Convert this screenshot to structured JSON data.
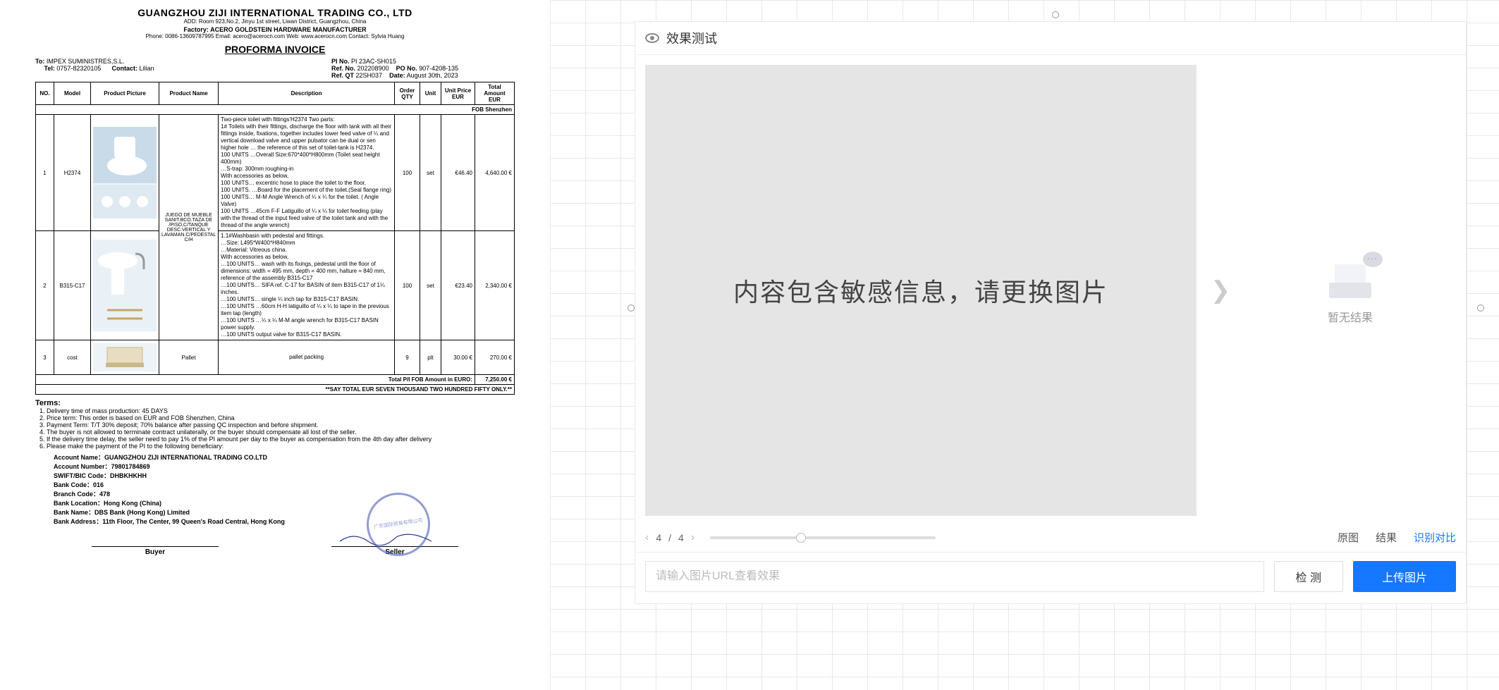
{
  "invoice": {
    "company": "GUANGZHOU ZIJI INTERNATIONAL TRADING CO., LTD",
    "address": "ADD: Room 923,No.2, Jinyu 1st street, Liwan District, Guangzhou, China",
    "factory": "Factory: ACERO GOLDSTEIN HARDWARE MANUFACTURER",
    "contacts": "Phone: 0086-13609787995    Email: acero@acerocn.com    Web: www.acerocn.com    Contact: Sylvia Huang",
    "title": "PROFORMA  INVOICE",
    "to_label": "To:",
    "to": "IMPEX SUMINISTRES,S.L.",
    "tel_label": "Tel:",
    "tel": "0757-82320105",
    "contact_label": "Contact:",
    "contact": "Lilian",
    "pi_no_label": "PI No.",
    "pi_no": "PI 23AC-SH015",
    "ref_no_label": "Ref. No.",
    "ref_no": "202208900",
    "po_no_label": "PO No.",
    "po_no": "907-4208-135",
    "ref_qt_label": "Ref. QT",
    "ref_qt": "22SH037",
    "date_label": "Date:",
    "date": "August 30th, 2023",
    "headers": {
      "no": "NO.",
      "model": "Model",
      "pic": "Product Picture",
      "name": "Product Name",
      "desc": "Description",
      "qty": "Order QTY",
      "unit": "Unit",
      "price": "Unit Price EUR",
      "amount": "Total Amount EUR"
    },
    "fob": "FOB Shenzhen",
    "name_block": "JUEGO DE MUEBLE SANIT.BCO.TAZA DE /PISO,C/TANQUE DESC.VERTICAL Y LAVAMAN.C/PEDESTAL C/H",
    "rows": [
      {
        "no": "1",
        "model": "H2374",
        "desc": "Two-piece toilet with fittings'H2374 Two parts:\n1# Toilets with their fittings, discharge the floor with tank with all their fittings inside, fixations, together includes lower feed valve of ¼ and vertical download valve and upper pulsator can be dual or sen higher hole … the reference of this set of toilet-tank is H2374.\n100 UNITS …Overall Size:670*400*H800mm (Toilet seat height 400mm)\n…S-trap: 300mm roughing-in\nWith accessories as below,\n100 UNITS… excentric hose to place the toilet to the floor,\n100 UNITS. …Board for the placement of the toilet.(Seal flange ring)\n100 UNITS… M-M Angle Wrench of ¼ x ¼ for the toilet. ( Angle Valve)\n100 UNITS …45cm F-F Latiguillo of ¼ x ¼ for toilet feeding (play with the thread of the input feed valve of the toilet tank and with the thread of the angle wrench)",
        "qty": "100",
        "unit": "set",
        "price": "€46.40",
        "amount": "4,640.00 €"
      },
      {
        "no": "2",
        "model": "B315-C17",
        "desc": "1.1#Washbasin with pedestal and fittings.\n…Size: L495*W400*H840mm\n…Material: Vitreous china.\nWith accessories as below,\n…100 UNITS… wash with its fixings, pedestal until the floor of dimensions: width = 495 mm, depth = 400 mm, halture = 840 mm, reference of the assembly B315-C17\n…100 UNITS… SIFA ref. C-17 for BASIN of item B315-C17 of 1¼ inches.\n…100 UNITS… single ¼ inch tap for B315-C17 BASIN.\n…100 UNITS …60cm H-H latiguillo of ¼ x ¼ to tape in the previous item tap (length)\n…100 UNITS …¼ x ¼ M-M angle wrench for B315-C17 BASIN power supply.\n…100 UNITS output valve for B315-C17 BASIN.",
        "qty": "100",
        "unit": "set",
        "price": "€23.40",
        "amount": "2,340.00 €"
      },
      {
        "no": "3",
        "model": "cost",
        "name": "Pallet",
        "desc": "pallet packing",
        "qty": "9",
        "unit": "plt",
        "price": "30.00 €",
        "amount": "270.00 €"
      }
    ],
    "total_label": "Total P/I FOB Amount in EURO:",
    "total": "7,250.00 €",
    "words": "**SAY TOTAL EUR SEVEN THOUSAND TWO HUNDRED FIFTY ONLY.**",
    "terms_hdr": "Terms:",
    "terms": [
      "Delivery time of mass production: 45 DAYS",
      "Price term: This order is based on EUR and FOB Shenzhen, China",
      "Payment Term: T/T 30% deposit; 70% balance after passing QC inspection and before shipment.",
      "The buyer is not allowed to terminate contract unilaterally, or the buyer should compensate all lost of the seller.",
      "If the delivery time delay,  the seller need to pay 1% of the PI amount per day to the buyer as compensation from the 4th day after delivery",
      "Please make the payment of the PI to the following beneficiary:"
    ],
    "bank": {
      "name_l": "Account Name：",
      "name": "GUANGZHOU ZIJI INTERNATIONAL TRADING CO.LTD",
      "num_l": "Account Number：",
      "num": "79801784869",
      "swift_l": "SWIFT/BIC Code：",
      "swift": "DHBKHKHH",
      "bankcode_l": "Bank Code：",
      "bankcode": "016",
      "branch_l": "Branch Code：",
      "branch": "478",
      "loc_l": "Bank Location：",
      "loc": "Hong Kong (China)",
      "bname_l": "Bank Name：",
      "bname": "DBS Bank (Hong Kong) Limited",
      "addr_l": "Bank Address：",
      "addr": "11th Floor, The Center, 99 Queen's Road Central, Hong Kong"
    },
    "buyer": "Buyer",
    "seller": "Seller",
    "stamp": "广东国际贸易有限公司"
  },
  "panel": {
    "title": "效果测试",
    "preview_msg": "内容包含敏感信息，请更换图片",
    "no_result": "暂无结果",
    "page_cur": "4",
    "page_sep": "/",
    "page_total": "4",
    "tabs": {
      "orig": "原图",
      "result": "结果",
      "compare": "识别对比"
    },
    "url_placeholder": "请输入图片URL查看效果",
    "btn_detect": "检 测",
    "btn_upload": "上传图片"
  }
}
